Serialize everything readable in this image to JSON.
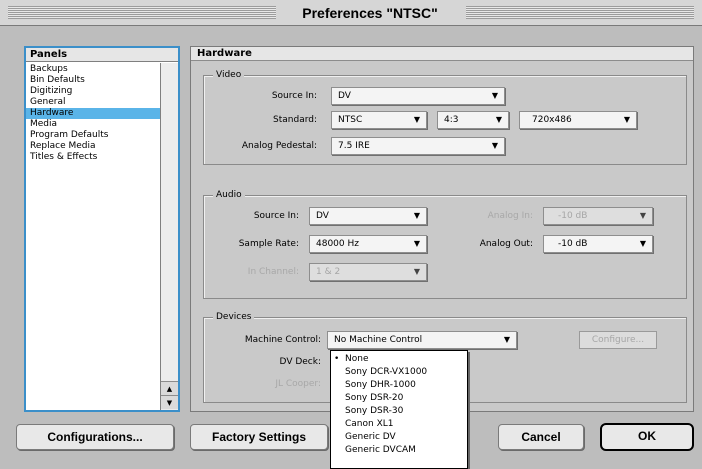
{
  "window": {
    "title": "Preferences \"NTSC\""
  },
  "panels": {
    "header": "Panels",
    "items": [
      "Backups",
      "Bin Defaults",
      "Digitizing",
      "General",
      "Hardware",
      "Media",
      "Program Defaults",
      "Replace Media",
      "Titles & Effects"
    ],
    "selected": "Hardware"
  },
  "hardware": {
    "header": "Hardware",
    "video": {
      "title": "Video",
      "source_label": "Source In:",
      "source_value": "DV",
      "standard_label": "Standard:",
      "standard_value": "NTSC",
      "aspect_value": "4:3",
      "resolution_value": "720x486",
      "pedestal_label": "Analog Pedestal:",
      "pedestal_value": "7.5 IRE"
    },
    "audio": {
      "title": "Audio",
      "source_label": "Source In:",
      "source_value": "DV",
      "analog_in_label": "Analog In:",
      "analog_in_value": "-10 dB",
      "sample_label": "Sample Rate:",
      "sample_value": "48000 Hz",
      "analog_out_label": "Analog Out:",
      "analog_out_value": "-10 dB",
      "channel_label": "In Channel:",
      "channel_value": "1 & 2"
    },
    "devices": {
      "title": "Devices",
      "machine_label": "Machine Control:",
      "machine_value": "No Machine Control",
      "configure_label": "Configure...",
      "dv_deck_label": "DV Deck:",
      "jl_cooper_label": "JL Cooper:",
      "dv_deck_options": [
        "None",
        "Sony DCR-VX1000",
        "Sony DHR-1000",
        "Sony DSR-20",
        "Sony DSR-30",
        "Canon XL1",
        "Generic DV",
        "Generic DVCAM"
      ],
      "dv_deck_selected": "None"
    }
  },
  "buttons": {
    "configurations": "Configurations...",
    "factory": "Factory Settings",
    "cancel": "Cancel",
    "ok": "OK"
  },
  "colors": {
    "selection": "#5ab4e8",
    "list_border": "#3b8fc9"
  }
}
